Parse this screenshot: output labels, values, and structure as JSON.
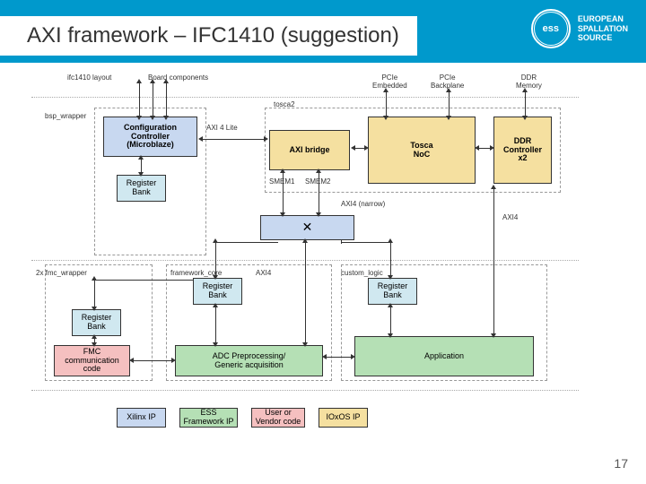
{
  "header": {
    "title": "AXI framework – IFC1410 (suggestion)",
    "logo_text": "ess",
    "org": "EUROPEAN\nSPALLATION\nSOURCE"
  },
  "labels": {
    "ifc": "ifc1410 layout",
    "board": "Board components",
    "bsp": "bsp_wrapper",
    "tosca2": "tosca2",
    "pcie_emb": "PCIe\nEmbedded",
    "pcie_back": "PCIe\nBackplane",
    "ddr": "DDR\nMemory",
    "axi4lite": "AXI 4 Lite",
    "smem1": "SMEM1",
    "smem2": "SMEM2",
    "axi4narrow": "AXI4 (narrow)",
    "axi4": "AXI4",
    "axi4_2": "AXI4",
    "fmc2x": "2x fmc_wrapper",
    "fwcore": "framework_core",
    "custom": "custom_logic"
  },
  "blocks": {
    "config": "Configuration\nController\n(Microblaze)",
    "regbank1": "Register\nBank",
    "axibridge": "AXI bridge",
    "tosca_noc": "Tosca\nNoC",
    "ddrctrl": "DDR\nController\nx2",
    "crossbar": "✕",
    "regbank2": "Register\nBank",
    "regbank3": "Register\nBank",
    "regbank4": "Register\nBank",
    "fmc": "FMC\ncommunication\ncode",
    "adc": "ADC Preprocessing/\nGeneric acquisition",
    "app": "Application"
  },
  "legend": {
    "xilinx": "Xilinx IP",
    "ess": "ESS\nFramework IP",
    "user": "User or\nVendor code",
    "ioxos": "IOxOS IP"
  },
  "page": "17"
}
